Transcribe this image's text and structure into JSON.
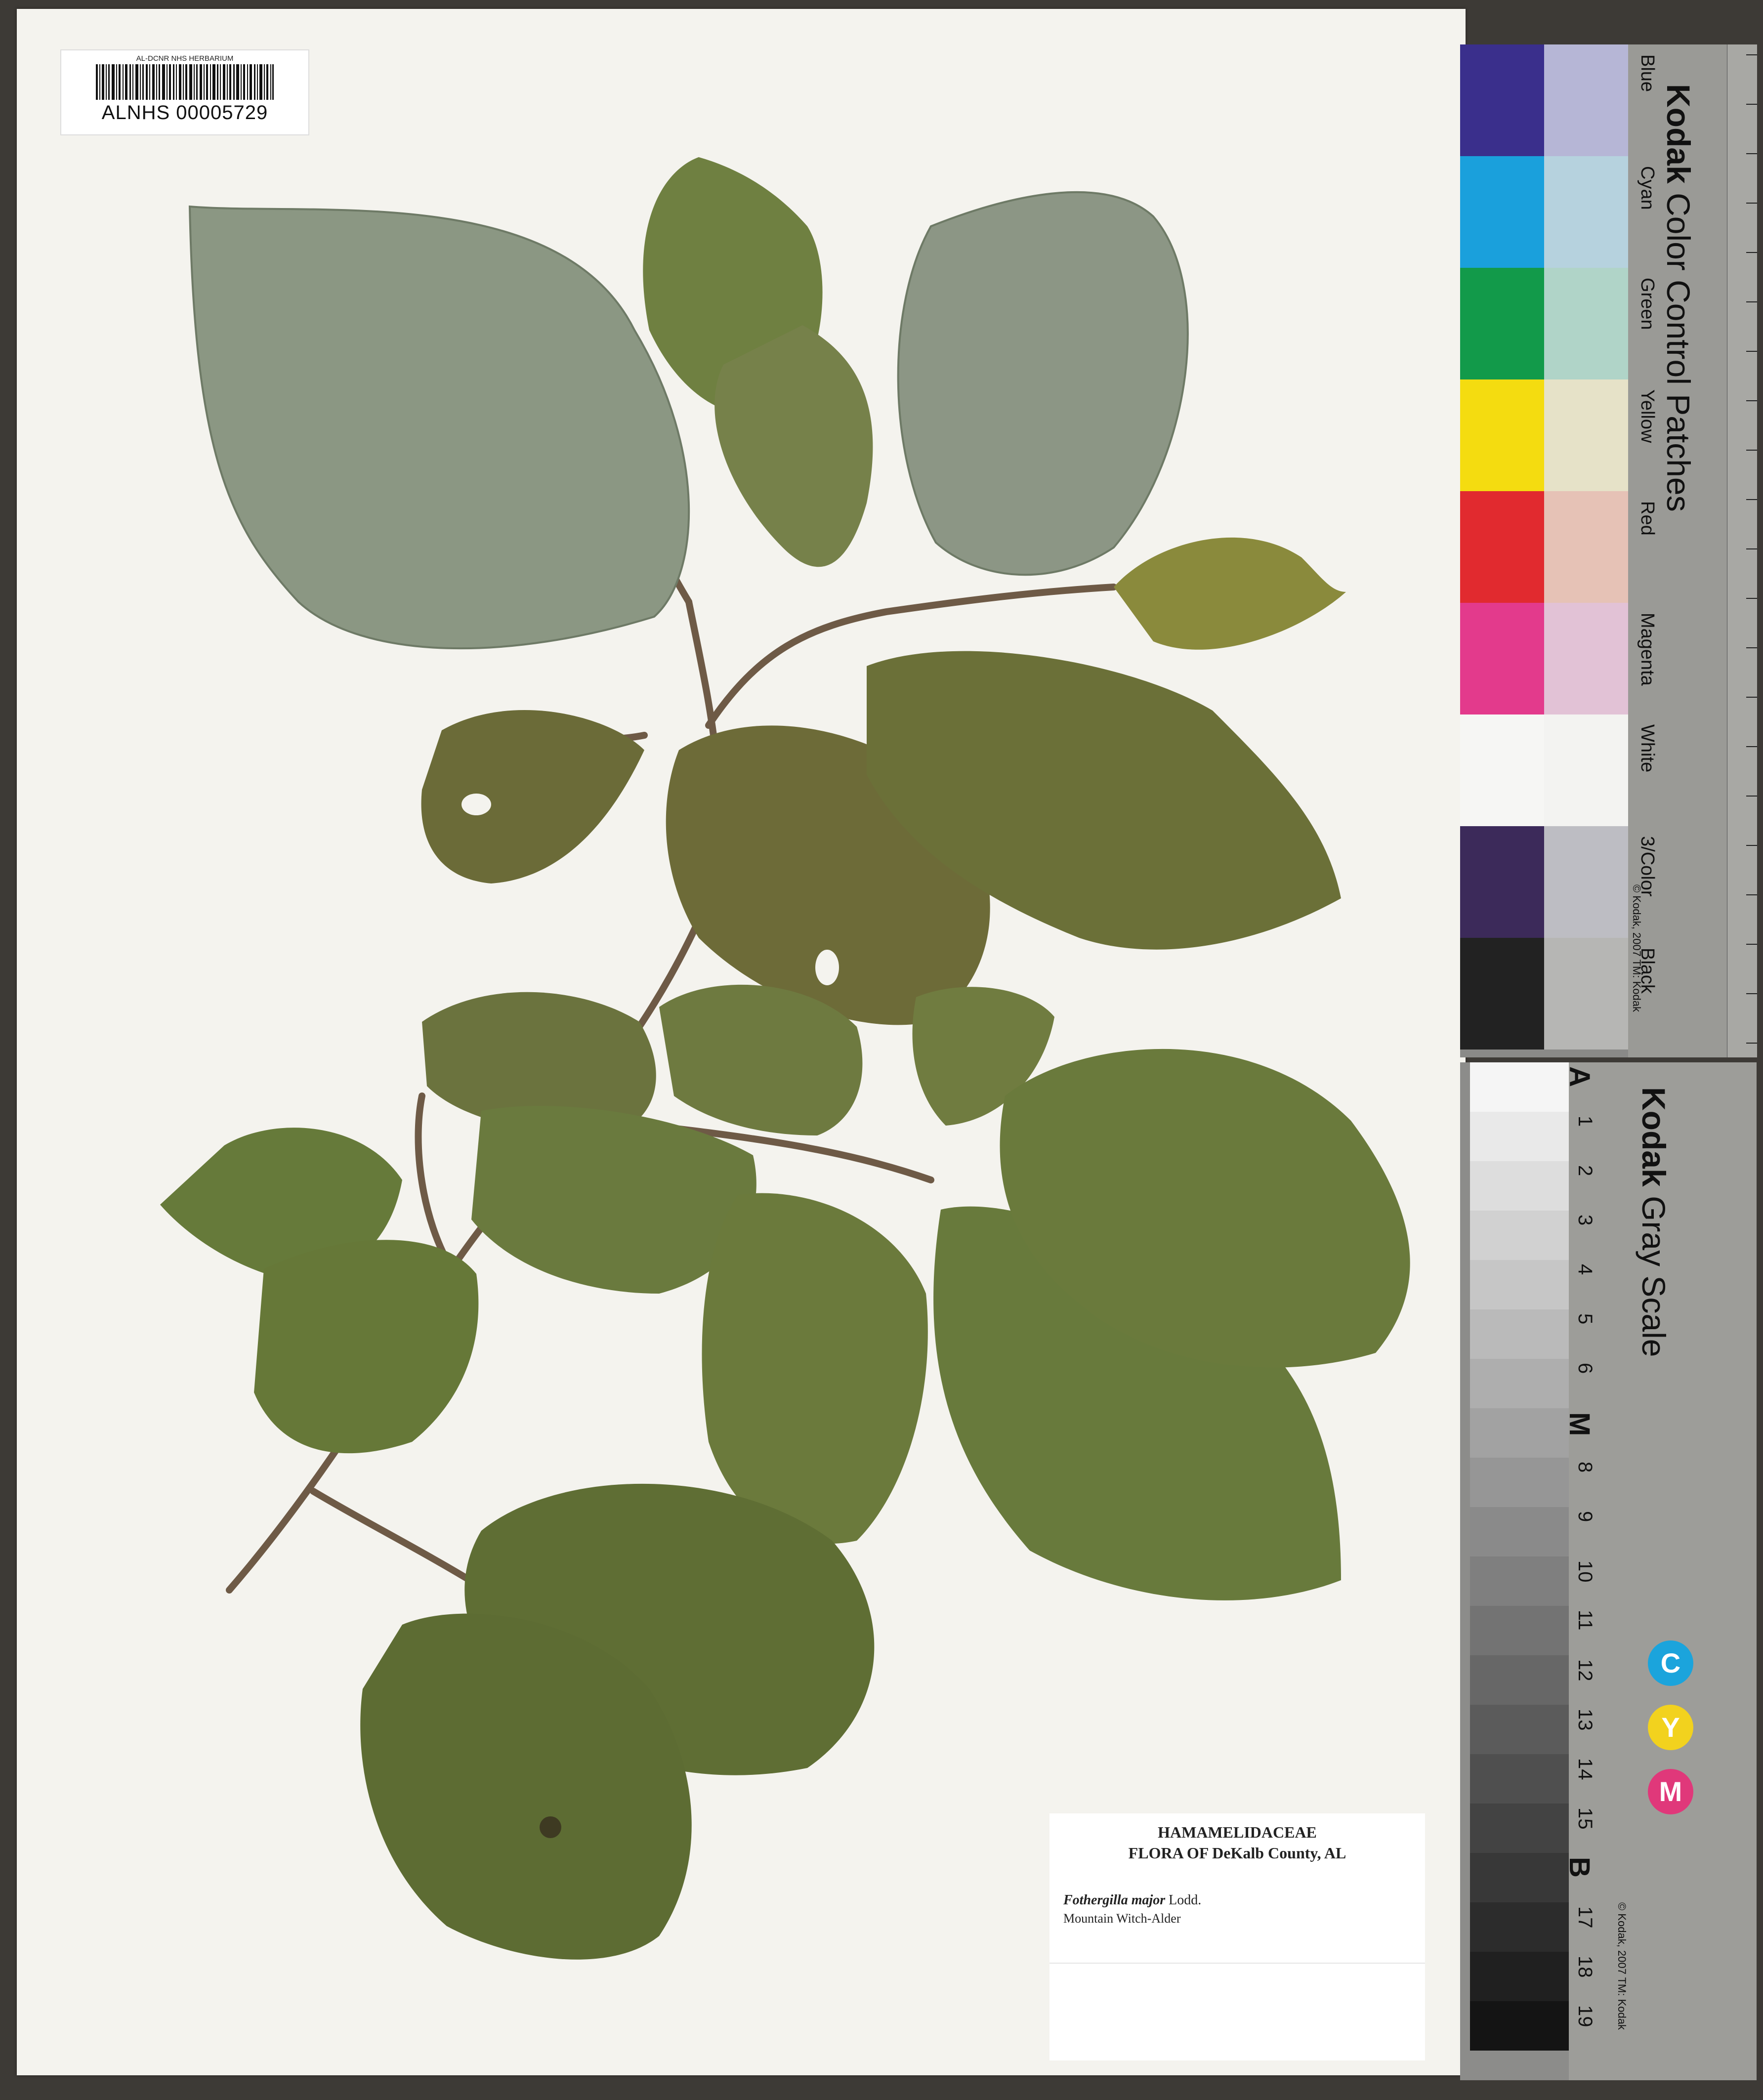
{
  "barcode": {
    "institution": "AL-DCNR NHS HERBARIUM",
    "accession": "ALNHS 00005729"
  },
  "label": {
    "family": "HAMAMELIDACEAE",
    "flora": "FLORA OF DeKalb County, AL",
    "scientific_name": "Fothergilla major",
    "author": "Lodd.",
    "common_name": "Mountain Witch-Alder"
  },
  "color_card": {
    "brand": "Kodak",
    "title": "Color Control Patches",
    "patch_names": [
      "Blue",
      "Cyan",
      "Green",
      "Yellow",
      "Red",
      "Magenta",
      "White",
      "3/Color",
      "Black"
    ],
    "patch_colors": [
      "#3a2f8c",
      "#1aa0dc",
      "#129a4a",
      "#f4dc10",
      "#e12a2f",
      "#e33a8c",
      "#f6f6f4",
      "#3c2a5a",
      "#222222"
    ],
    "patch_tints": [
      "#b6b6d6",
      "#b6d2de",
      "#b0d4c8",
      "#e6e2c8",
      "#e6c2b6",
      "#e2c2d6",
      "#f3f3f1",
      "#bdbdc3",
      "#b6b6b4"
    ],
    "copyright": "© Kodak, 2007 TM: Kodak",
    "ruler_units": [
      "inches",
      "cm"
    ]
  },
  "gray_card": {
    "brand": "Kodak",
    "title": "Gray Scale",
    "steps": [
      "A",
      "1",
      "2",
      "3",
      "4",
      "5",
      "6",
      "M",
      "8",
      "9",
      "10",
      "11",
      "12",
      "13",
      "14",
      "15",
      "B",
      "17",
      "18",
      "19"
    ],
    "cmy": [
      {
        "letter": "C",
        "color": "#1ba4dc"
      },
      {
        "letter": "Y",
        "color": "#f2d21e"
      },
      {
        "letter": "M",
        "color": "#e0387a"
      }
    ],
    "copyright": "© Kodak, 2007 TM: Kodak"
  }
}
